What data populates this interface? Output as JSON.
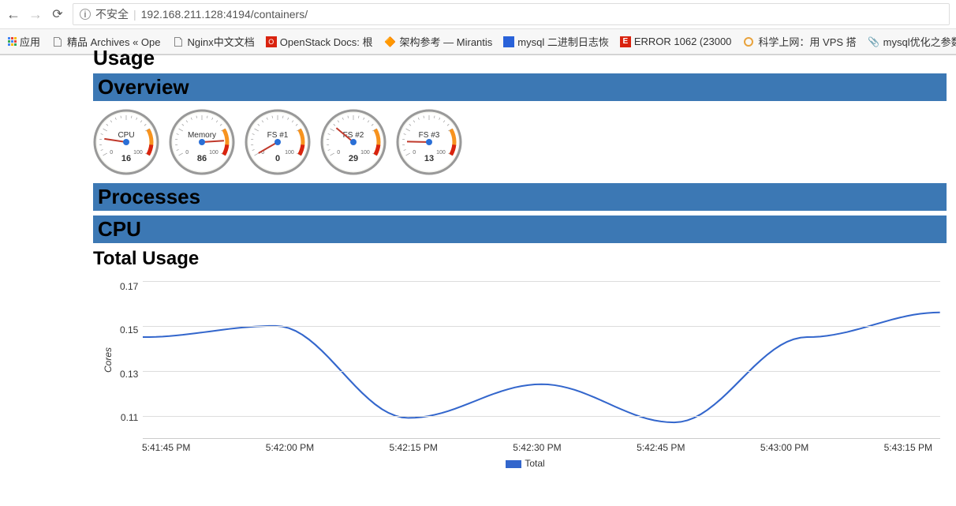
{
  "browser": {
    "security_label": "不安全",
    "url": "192.168.211.128:4194/containers/"
  },
  "bookmarks": {
    "apps": "应用",
    "items": [
      {
        "label": "精品 Archives « Ope"
      },
      {
        "label": "Nginx中文文档"
      },
      {
        "label": "OpenStack Docs: 根"
      },
      {
        "label": "架构参考 — Mirantis"
      },
      {
        "label": "mysql 二进制日志恢"
      },
      {
        "label": "ERROR 1062 (23000"
      },
      {
        "label": "科学上网：用 VPS 搭"
      },
      {
        "label": "mysql优化之参数优"
      }
    ]
  },
  "headers": {
    "usage_cut": "Usage",
    "overview": "Overview",
    "processes": "Processes",
    "cpu": "CPU",
    "total_usage": "Total Usage"
  },
  "gauges": [
    {
      "label": "CPU",
      "value": "16",
      "pct": 16
    },
    {
      "label": "Memory",
      "value": "86",
      "pct": 86
    },
    {
      "label": "FS #1",
      "value": "0",
      "pct": 0
    },
    {
      "label": "FS #2",
      "value": "29",
      "pct": 29
    },
    {
      "label": "FS #3",
      "value": "13",
      "pct": 13
    }
  ],
  "gauge_ticks": {
    "min": "0",
    "max": "100"
  },
  "chart": {
    "ylabel": "Cores",
    "legend": "Total"
  },
  "chart_data": {
    "type": "line",
    "title": "Total Usage",
    "xlabel": "",
    "ylabel": "Cores",
    "ylim": [
      0.1,
      0.17
    ],
    "y_ticks": [
      "0.17",
      "0.15",
      "0.13",
      "0.11"
    ],
    "x_ticks": [
      "5:41:45 PM",
      "5:42:00 PM",
      "5:42:15 PM",
      "5:42:30 PM",
      "5:42:45 PM",
      "5:43:00 PM",
      "5:43:15 PM"
    ],
    "series": [
      {
        "name": "Total",
        "x": [
          "5:41:45 PM",
          "5:42:00 PM",
          "5:42:15 PM",
          "5:42:30 PM",
          "5:42:45 PM",
          "5:43:00 PM",
          "5:43:15 PM"
        ],
        "values": [
          0.145,
          0.15,
          0.109,
          0.124,
          0.107,
          0.145,
          0.156
        ]
      }
    ]
  }
}
